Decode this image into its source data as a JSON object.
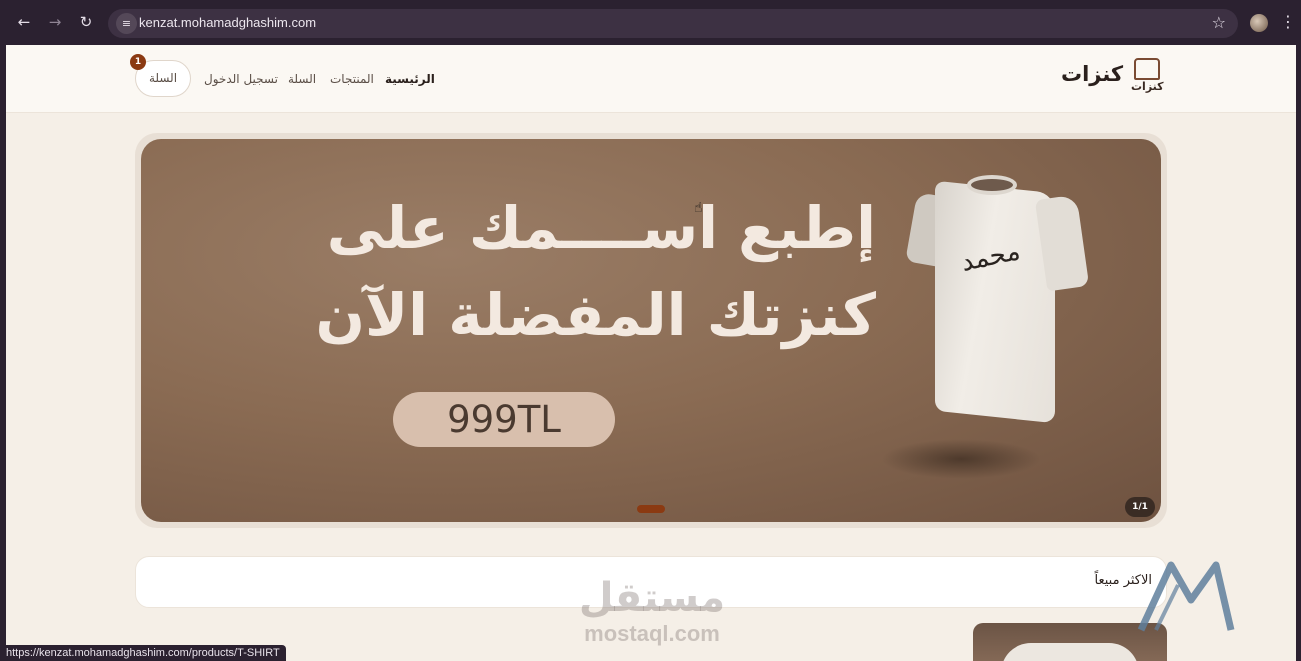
{
  "browser": {
    "url": "kenzat.mohamadghashim.com",
    "status_url": "https://kenzat.mohamadghashim.com/products/T-SHIRT"
  },
  "header": {
    "logo_text": "كنزات",
    "logo_mark_text": "كنزات",
    "nav": {
      "home": "الرئيسية",
      "products": "المنتجات",
      "cart": "السلة",
      "login": "تسجيل الدخول"
    },
    "cart_button": "السلة",
    "cart_count": "1"
  },
  "hero": {
    "line1": "إطبع اســــمك على",
    "line2": "كنزتك المفضلة الآن",
    "price": "999TL",
    "shirt_print": "محمد",
    "counter": "1/1"
  },
  "best_sellers": {
    "title": "الاكثر مبيعاً"
  },
  "watermark": {
    "arabic": "مستقل",
    "latin": "mostaql.com"
  },
  "colors": {
    "accent": "#8b3a12",
    "page_bg": "#f5efe7",
    "hero_bg": "#8a6b53",
    "price_pill": "#d8bfad"
  }
}
